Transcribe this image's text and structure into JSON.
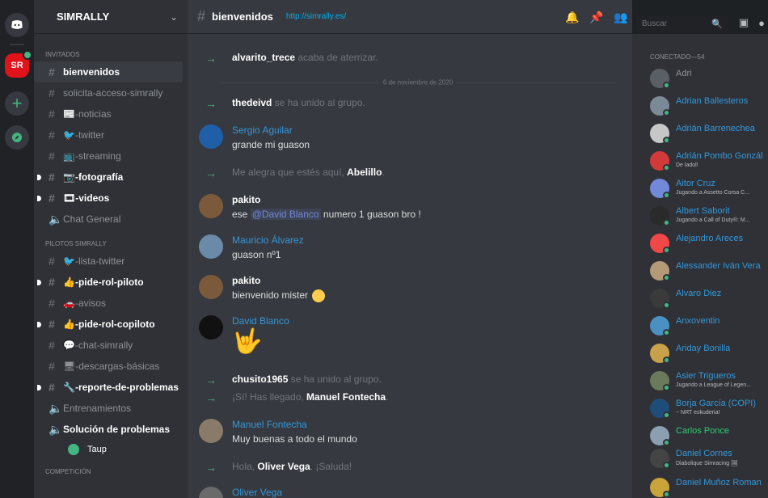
{
  "app": {
    "server_name": "SIMRALLY",
    "channel_name": "bienvenidos",
    "channel_topic": "http://simrally.es/",
    "search_placeholder": "Buscar",
    "guild_server_label": "SR"
  },
  "sidebar": {
    "categories": [
      {
        "label": "INVITADOS"
      },
      {
        "label": "PILOTOS SIMRALLY"
      },
      {
        "label": "COMPETICIÓN"
      }
    ],
    "channels": [
      {
        "label": "bienvenidos"
      },
      {
        "label": "solicita-acceso-simrally"
      },
      {
        "label": "📰-noticias"
      },
      {
        "label": "🐦-twitter"
      },
      {
        "label": "📺-streaming"
      },
      {
        "label": "📷-fotografía"
      },
      {
        "label": "🎞-videos"
      },
      {
        "label": "Chat General"
      },
      {
        "label": "🐦-lista-twitter"
      },
      {
        "label": "👍-pide-rol-piloto"
      },
      {
        "label": "🚗-avisos"
      },
      {
        "label": "👍-pide-rol-copiloto"
      },
      {
        "label": "💬-chat-simrally"
      },
      {
        "label": "🖥-descargas-básicas"
      },
      {
        "label": "🔧-reporte-de-problemas"
      },
      {
        "label": "Entrenamientos"
      },
      {
        "label": "Solución de problemas"
      }
    ],
    "voice_user": "Taup"
  },
  "messages": [
    {
      "user": "alvarito_trece",
      "text": " acaba de aterrizar."
    },
    {
      "divider": "6 de noviembre de 2020"
    },
    {
      "user": "thedeivd",
      "text": " se ha unido al grupo."
    },
    {
      "author": "Sergio Aguilar",
      "body": "grande mi guason"
    },
    {
      "prefix": "Me alegra que estés aquí, ",
      "user": "Abelillo",
      "suffix": "."
    },
    {
      "author": "pakito",
      "body_pre": "ese ",
      "mention": "@David Blanco",
      "body_post": "  numero 1 guason bro !"
    },
    {
      "author": "Mauricio Álvarez",
      "body": "guason nº1"
    },
    {
      "author": "pakito",
      "body": "bienvenido mister"
    },
    {
      "author": "David Blanco",
      "emoji": "🤟"
    },
    {
      "user": "chusito1965",
      "text": " se ha unido al grupo."
    },
    {
      "prefix": "¡Sí! Has llegado, ",
      "user": "Manuel Fontecha",
      "suffix": "."
    },
    {
      "author": "Manuel Fontecha",
      "body": "Muy buenas a todo el mundo"
    },
    {
      "prefix": "Hola, ",
      "user": "Oliver Vega",
      "suffix": ". ¡Saluda!"
    },
    {
      "author": "Oliver Vega"
    }
  ],
  "members": {
    "header": "CONECTADO—54",
    "list": [
      {
        "name": "Adri",
        "color": "#8e9297"
      },
      {
        "name": "Adrian Ballesteros",
        "color": "#3498db"
      },
      {
        "name": "Adrián Barrenechea",
        "color": "#3498db"
      },
      {
        "name": "Adrián Pombo Gonzál",
        "color": "#3498db",
        "sub": "De ladol!"
      },
      {
        "name": "Aitor Cruz",
        "color": "#3498db",
        "sub": "Jugando a Assetto Corsa C..."
      },
      {
        "name": "Albert Saborit",
        "color": "#3498db",
        "sub": "Jugando a Call of Duty®: M..."
      },
      {
        "name": "Alejandro Areces",
        "color": "#3498db"
      },
      {
        "name": "Alessander Iván Vera",
        "color": "#3498db"
      },
      {
        "name": "Alvaro Diez",
        "color": "#3498db"
      },
      {
        "name": "Anxoventin",
        "color": "#3498db"
      },
      {
        "name": "Ariday Bonilla",
        "color": "#3498db"
      },
      {
        "name": "Asier Trigueros",
        "color": "#3498db",
        "sub": "Jugando a League of Legen..."
      },
      {
        "name": "Borja García (COPI)",
        "color": "#3498db",
        "sub": "~ NRT eskuderia!"
      },
      {
        "name": "Carlos Ponce",
        "color": "#2ecc71"
      },
      {
        "name": "Daniel Cornes",
        "color": "#3498db",
        "sub": "Diabolique Simracing 🖼"
      },
      {
        "name": "Daniel Muñoz Roman",
        "color": "#3498db"
      }
    ]
  }
}
